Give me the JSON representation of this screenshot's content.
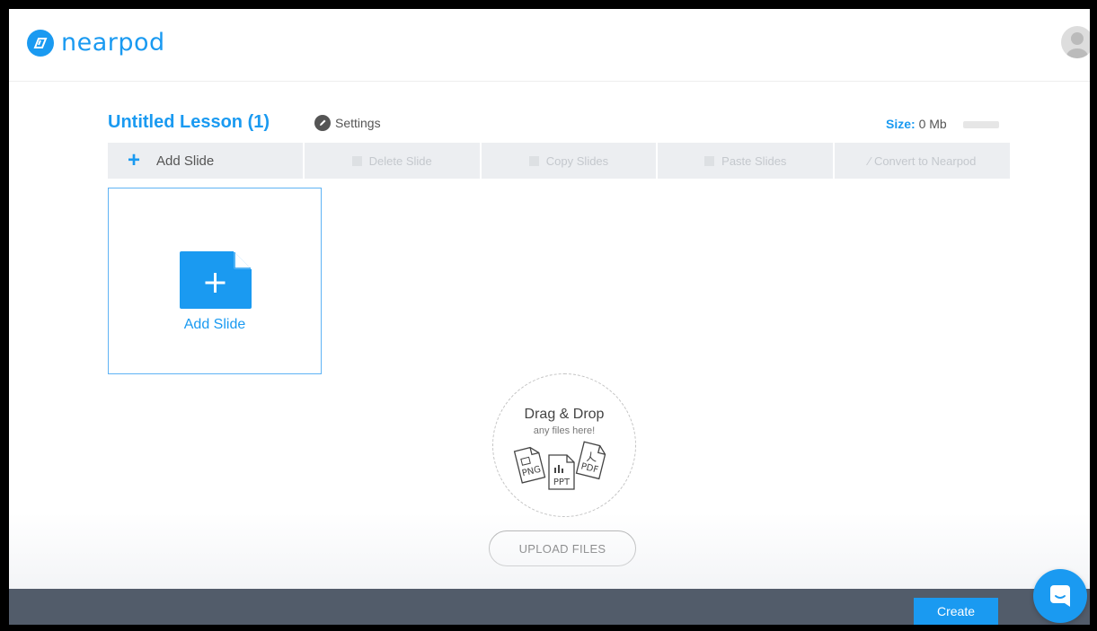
{
  "app": {
    "logo_text": "nearpod"
  },
  "lesson": {
    "title": "Untitled Lesson (1)",
    "settings_label": "Settings",
    "size_label": "Size:",
    "size_value": "0 Mb"
  },
  "toolbar": {
    "add_slide_label": "Add Slide",
    "items": [
      {
        "label": "Delete Slide",
        "icon": "trash-icon"
      },
      {
        "label": "Copy Slides",
        "icon": "copy-icon"
      },
      {
        "label": "Paste Slides",
        "icon": "paste-icon"
      },
      {
        "label": "Convert to Nearpod",
        "icon": "convert-icon"
      }
    ]
  },
  "add_card": {
    "label": "Add Slide"
  },
  "dropzone": {
    "title": "Drag & Drop",
    "subtitle": "any files here!",
    "file_types": [
      "PNG",
      "PPT",
      "PDF"
    ]
  },
  "upload": {
    "label": "UPLOAD FILES"
  },
  "footer": {
    "create_label": "Create"
  },
  "colors": {
    "accent": "#1a9af1",
    "footer_bg": "#525c6a"
  }
}
